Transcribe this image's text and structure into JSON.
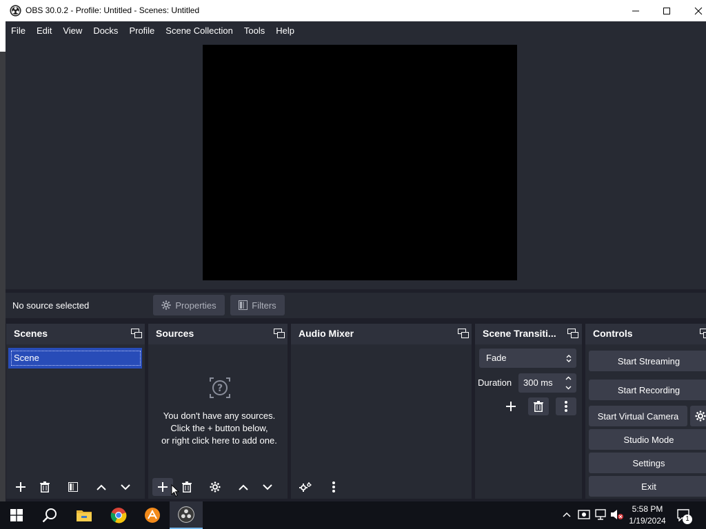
{
  "window": {
    "title": "OBS 30.0.2 - Profile: Untitled - Scenes: Untitled"
  },
  "menu": [
    "File",
    "Edit",
    "View",
    "Docks",
    "Profile",
    "Scene Collection",
    "Tools",
    "Help"
  ],
  "context_bar": {
    "status": "No source selected",
    "properties_label": "Properties",
    "filters_label": "Filters"
  },
  "docks": {
    "scenes": {
      "title": "Scenes",
      "items": [
        "Scene"
      ]
    },
    "sources": {
      "title": "Sources",
      "empty_line1": "You don't have any sources.",
      "empty_line2": "Click the + button below,",
      "empty_line3": "or right click here to add one."
    },
    "audio_mixer": {
      "title": "Audio Mixer"
    },
    "transitions": {
      "title": "Scene Transiti...",
      "selected": "Fade",
      "duration_label": "Duration",
      "duration_value": "300 ms"
    },
    "controls": {
      "title": "Controls",
      "start_streaming": "Start Streaming",
      "start_recording": "Start Recording",
      "start_virtual_camera": "Start Virtual Camera",
      "studio_mode": "Studio Mode",
      "settings": "Settings",
      "exit": "Exit"
    }
  },
  "taskbar": {
    "time": "5:58 PM",
    "date": "1/19/2024",
    "notification_count": "1"
  },
  "colors": {
    "dock_bg": "#272a33",
    "button_bg": "#3b3e4b",
    "selected_scene": "#284cb8",
    "preview": "#000000"
  }
}
